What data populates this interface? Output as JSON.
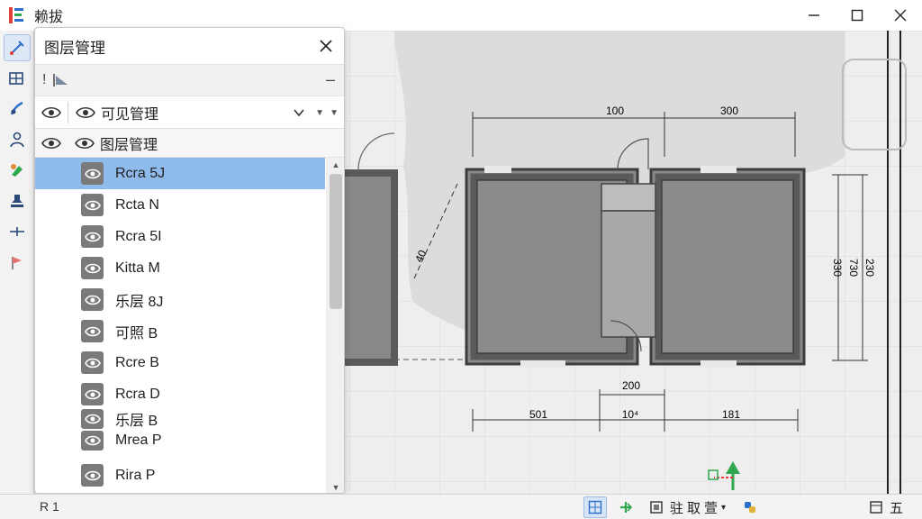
{
  "window": {
    "title": "赖拔"
  },
  "panel": {
    "title": "图层管理",
    "toolbar_glyph": "!",
    "filter": {
      "label": "可见管理"
    },
    "list_header": {
      "label": "图层管理"
    },
    "rows": [
      {
        "name": "Rcra 5J",
        "selected": true
      },
      {
        "name": "Rcta N",
        "selected": false
      },
      {
        "name": "Rcra 5I",
        "selected": false
      },
      {
        "name": "Kitta M",
        "selected": false
      },
      {
        "name": "乐层 8J",
        "selected": false
      },
      {
        "name": "可照 B",
        "selected": false
      },
      {
        "name": "Rcre B",
        "selected": false
      },
      {
        "name": "Rcra D",
        "selected": false
      },
      {
        "name": "乐层 B",
        "selected": false
      },
      {
        "name": "Mrea P",
        "selected": false
      },
      {
        "name": "Rira P",
        "selected": false
      }
    ]
  },
  "drawing": {
    "dimensions": {
      "top_left": "100",
      "top_right": "300",
      "left_diag": "40",
      "right_a": "330",
      "right_b": "730",
      "right_c": "230",
      "bottom_mid": "200",
      "bottom_left": "501",
      "bottom_center": "10⁴",
      "bottom_right": "181"
    }
  },
  "statusbar": {
    "left_text": "R 1",
    "text1": "驻",
    "text2": "取",
    "text3": "萱",
    "text4": "五"
  },
  "colors": {
    "selection": "#8fbaec",
    "wall": "#5a5a5a",
    "room_fill": "#888888",
    "accent_green": "#2fa84f",
    "accent_blue": "#2a6fc9"
  }
}
